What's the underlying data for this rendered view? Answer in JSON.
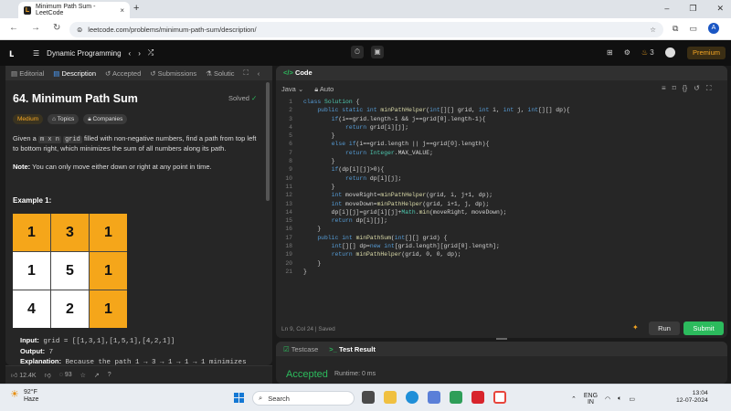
{
  "browser": {
    "tab_title": "Minimum Path Sum - LeetCode",
    "tab_close": "×",
    "new_tab": "+",
    "url": "leetcode.com/problems/minimum-path-sum/description/",
    "profile_initial": "A"
  },
  "lc_nav": {
    "list_name": "Dynamic Programming",
    "streak": "3",
    "premium": "Premium"
  },
  "left_tabs": [
    "Editorial",
    "Description",
    "Accepted",
    "Submissions",
    "Solutic"
  ],
  "problem": {
    "title": "64. Minimum Path Sum",
    "status": "Solved",
    "difficulty": "Medium",
    "tags": [
      "Topics",
      "Companies"
    ],
    "desc_pre": "Given a",
    "desc_code1": "m x n",
    "desc_code2": "grid",
    "desc_post": "filled with non-negative numbers, find a path from top left to bottom right, which minimizes the sum of all numbers along its path.",
    "note_label": "Note:",
    "note_text": "You can only move either down or right at any point in time.",
    "example_title": "Example 1:",
    "grid": [
      [
        1,
        3,
        1
      ],
      [
        1,
        5,
        1
      ],
      [
        4,
        2,
        1
      ]
    ],
    "path": [
      [
        true,
        true,
        true
      ],
      [
        false,
        false,
        true
      ],
      [
        false,
        false,
        true
      ]
    ],
    "input_label": "Input:",
    "input_value": "grid = [[1,3,1],[1,5,1],[4,2,1]]",
    "output_label": "Output:",
    "output_value": "7",
    "explanation_label": "Explanation:",
    "explanation_value": "Because the path 1 → 3 → 1 → 1 → 1 minimizes"
  },
  "left_bar": {
    "likes": "12.4K",
    "comments": "93"
  },
  "editor": {
    "header": "Code",
    "language": "Java",
    "autosave": "Auto",
    "status": "Ln 9, Col 24  |  Saved",
    "run": "Run",
    "submit": "Submit",
    "lines": [
      "class Solution {",
      "    public static int minPathHelper(int[][] grid, int i, int j, int[][] dp){",
      "        if(i==grid.length-1 && j==grid[0].length-1){",
      "            return grid[i][j];",
      "        }",
      "        else if(i==grid.length || j==grid[0].length){",
      "            return Integer.MAX_VALUE;",
      "        }",
      "        if(dp[i][j]>0){",
      "            return dp[i][j];",
      "        }",
      "        int moveRight=minPathHelper(grid, i, j+1, dp);",
      "        int moveDown=minPathHelper(grid, i+1, j, dp);",
      "        dp[i][j]=grid[i][j]+Math.min(moveRight, moveDown);",
      "        return dp[i][j];",
      "    }",
      "    public int minPathSum(int[][] grid) {",
      "        int[][] dp=new int[grid.length][grid[0].length];",
      "        return minPathHelper(grid, 0, 0, dp);",
      "    }",
      "}"
    ]
  },
  "bottom": {
    "tab_testcase": "Testcase",
    "tab_result": "Test Result",
    "result": "Accepted",
    "runtime": "Runtime: 0 ms"
  },
  "taskbar": {
    "temp": "92°F",
    "weather": "Haze",
    "search": "Search",
    "lang1": "ENG",
    "lang2": "IN",
    "time": "13:04",
    "date": "12-07-2024"
  }
}
